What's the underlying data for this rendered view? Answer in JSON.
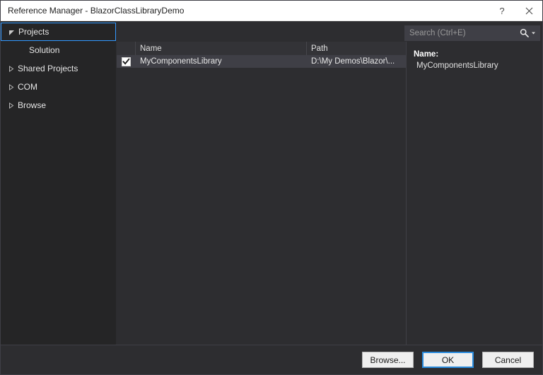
{
  "window": {
    "title": "Reference Manager - BlazorClassLibraryDemo",
    "help_label": "?",
    "close_label": "✕",
    "accent_color": "#3399ff",
    "titlebar_bg": "#ffffff",
    "chrome_bg": "#2d2d30"
  },
  "sidebar": {
    "items": [
      {
        "label": "Projects",
        "state": "expanded",
        "selected": true,
        "level": 0
      },
      {
        "label": "Solution",
        "state": "leaf",
        "selected": false,
        "level": 1
      },
      {
        "label": "Shared Projects",
        "state": "collapsed",
        "selected": false,
        "level": 0
      },
      {
        "label": "COM",
        "state": "collapsed",
        "selected": false,
        "level": 0
      },
      {
        "label": "Browse",
        "state": "collapsed",
        "selected": false,
        "level": 0
      }
    ]
  },
  "search": {
    "placeholder": "Search (Ctrl+E)",
    "value": "",
    "icon": "search-icon",
    "dropdown_icon": "chevron-down-icon"
  },
  "list": {
    "columns": [
      {
        "key": "check",
        "label": ""
      },
      {
        "key": "name",
        "label": "Name"
      },
      {
        "key": "path",
        "label": "Path"
      }
    ],
    "rows": [
      {
        "checked": true,
        "name": "MyComponentsLibrary",
        "path": "D:\\My Demos\\Blazor\\...",
        "selected": true
      }
    ]
  },
  "details": {
    "name_key": "Name:",
    "name_value": "MyComponentsLibrary"
  },
  "footer": {
    "browse_label": "Browse...",
    "ok_label": "OK",
    "cancel_label": "Cancel"
  }
}
